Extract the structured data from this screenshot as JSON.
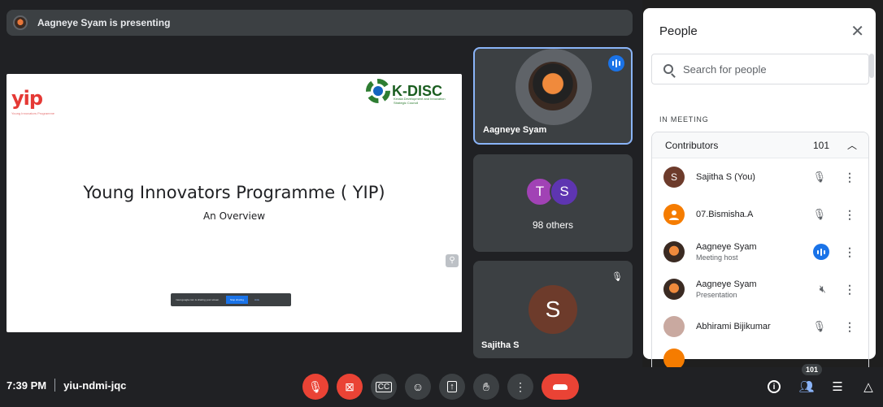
{
  "presenting_banner": "Aagneye Syam is presenting",
  "slide": {
    "logo_text": "yip",
    "logo_subtext": "Young Innovators Programme",
    "partner_logo": "K-DISC",
    "partner_subtext": "Kerala Development and Innovation Strategic Council",
    "title": "Young Innovators Programme ( YIP)",
    "subtitle": "An Overview",
    "share_toast": {
      "text": "meet.google.com is sharing your screen.",
      "stop_label": "Stop sharing",
      "hide_label": "Hide"
    }
  },
  "tiles": [
    {
      "name": "Aagneye Syam",
      "speaking": true
    },
    {
      "label": "98 others",
      "avatars": [
        {
          "letter": "T",
          "color": "#a142b5"
        },
        {
          "letter": "S",
          "color": "#5e35b1"
        }
      ]
    },
    {
      "name": "Sajitha S",
      "letter": "S",
      "muted": true
    }
  ],
  "bottom_bar": {
    "time": "7:39 PM",
    "meeting_code": "yiu-ndmi-jqc",
    "people_count": "101",
    "controls": [
      "mic-off-icon",
      "camera-off-icon",
      "captions-icon",
      "emoji-icon",
      "present-icon",
      "raise-hand-icon",
      "more-icon",
      "end-call-icon"
    ],
    "right_icons": [
      "info-icon",
      "people-icon",
      "chat-icon",
      "activities-icon"
    ]
  },
  "people_panel": {
    "title": "People",
    "search_placeholder": "Search for people",
    "section_label": "IN MEETING",
    "group_label": "Contributors",
    "group_count": "101",
    "participants": [
      {
        "name": "Sajitha S (You)",
        "sub": "",
        "letter": "S",
        "avatar_color": "#6d3b2b",
        "status": "muted"
      },
      {
        "name": "07.Bismisha.A",
        "sub": "",
        "letter": "",
        "avatar_color": "#f57c00",
        "status": "muted"
      },
      {
        "name": "Aagneye Syam",
        "sub": "Meeting host",
        "letter": "",
        "avatar_color": "#3a2a22",
        "status": "speaking"
      },
      {
        "name": "Aagneye Syam",
        "sub": "Presentation",
        "letter": "",
        "avatar_color": "#3a2a22",
        "status": "presenting"
      },
      {
        "name": "Abhirami Bijikumar",
        "sub": "",
        "letter": "",
        "avatar_color": "#c9a9a0",
        "status": "muted"
      }
    ]
  },
  "colors": {
    "accent": "#1a73e8",
    "danger": "#ea4335",
    "surface": "#3c4043"
  }
}
